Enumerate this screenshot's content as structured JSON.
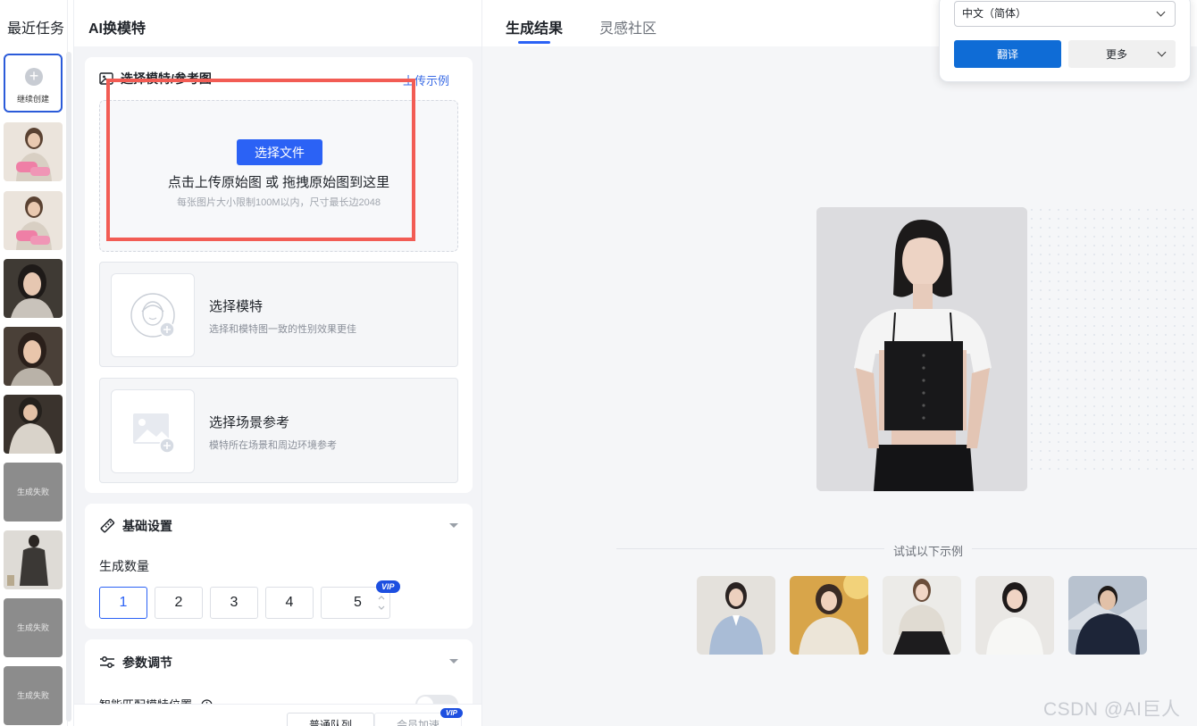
{
  "recent": {
    "title": "最近任务",
    "continue_label": "继续创建",
    "fail_label": "生成失败"
  },
  "panel": {
    "title": "AI换模特",
    "upload": {
      "heading": "选择模特/参考图",
      "example_link": "上传示例",
      "button": "选择文件",
      "main_text": "点击上传原始图 或 拖拽原始图到这里",
      "sub_text": "每张图片大小限制100M以内，尺寸最长边2048"
    },
    "model_pick": {
      "title": "选择模特",
      "desc": "选择和模特图一致的性别效果更佳"
    },
    "scene_pick": {
      "title": "选择场景参考",
      "desc": "模特所在场景和周边环境参考"
    },
    "basic": {
      "heading": "基础设置",
      "count_label": "生成数量",
      "counts": [
        "1",
        "2",
        "3",
        "4",
        "5"
      ],
      "selected": "1",
      "vip_badge": "VIP"
    },
    "params": {
      "heading": "参数调节",
      "smart_match_label": "智能匹配模特位置"
    },
    "bottom": {
      "normal_queue": "普通队列",
      "member_speed": "会员加速",
      "vip_badge": "VIP"
    }
  },
  "result": {
    "tabs": [
      "生成结果",
      "灵感社区"
    ],
    "active_tab": "生成结果",
    "examples_label": "试试以下示例"
  },
  "translate": {
    "language": "中文（简体）",
    "translate_btn": "翻译",
    "more_btn": "更多"
  },
  "watermark": "CSDN @AI巨人",
  "colors": {
    "accent": "#2b62f5",
    "highlight_box": "#f25c54",
    "fail_tile": "#8c8c8c",
    "translate_button": "#0f6cd6"
  }
}
